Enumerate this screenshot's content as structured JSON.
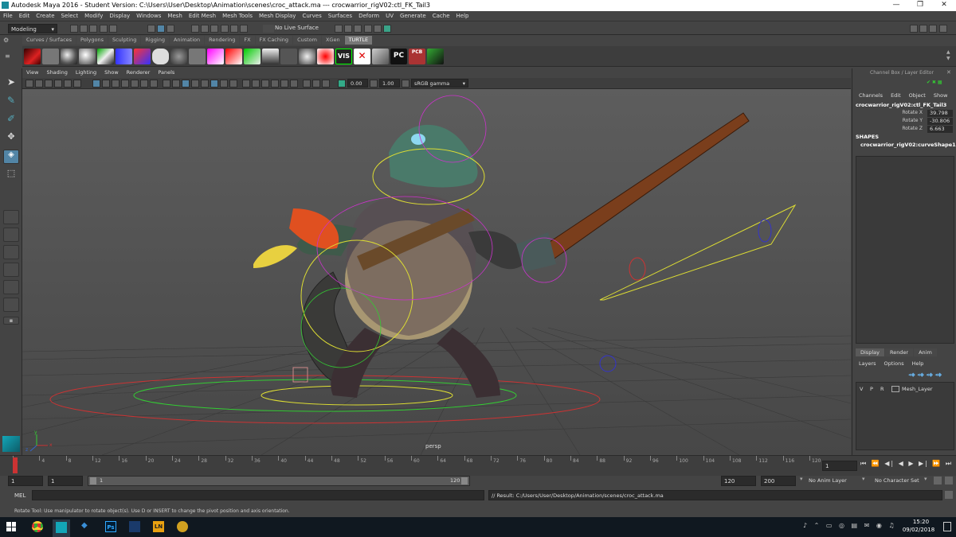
{
  "window": {
    "title": "Autodesk Maya 2016 - Student Version: C:\\Users\\User\\Desktop\\Animation\\scenes\\croc_attack.ma   ---   crocwarrior_rigV02:ctl_FK_Tail3",
    "minimize": "—",
    "maximize": "❐",
    "close": "✕"
  },
  "menubar": [
    "File",
    "Edit",
    "Create",
    "Select",
    "Modify",
    "Display",
    "Windows",
    "Mesh",
    "Edit Mesh",
    "Mesh Tools",
    "Mesh Display",
    "Curves",
    "Surfaces",
    "Deform",
    "UV",
    "Generate",
    "Cache",
    "Help"
  ],
  "statusline": {
    "menuset": "Modeling",
    "live_surface": "No Live Surface"
  },
  "shelf_tabs": [
    "Curves / Surfaces",
    "Polygons",
    "Sculpting",
    "Rigging",
    "Animation",
    "Rendering",
    "FX",
    "FX Caching",
    "Custom",
    "XGen",
    "TURTLE"
  ],
  "shelf_tab_active": "TURTLE",
  "shelf_labels": {
    "vis": "VIS",
    "pc": "PC",
    "pcb": "PCB"
  },
  "viewport": {
    "menu": [
      "View",
      "Shading",
      "Lighting",
      "Show",
      "Renderer",
      "Panels"
    ],
    "exposure": "0.00",
    "gamma": "1.00",
    "colorspace": "sRGB gamma",
    "camera_label": "persp",
    "axis_x": "x",
    "axis_y": "y",
    "axis_z": "z"
  },
  "channel_box": {
    "header": "Channel Box / Layer Editor",
    "menu": [
      "Channels",
      "Edit",
      "Object",
      "Show"
    ],
    "object_name": "crocwarrior_rigV02:ctl_FK_Tail3",
    "channels": [
      {
        "name": "Rotate X",
        "value": "39.798"
      },
      {
        "name": "Rotate Y",
        "value": "-30.806"
      },
      {
        "name": "Rotate Z",
        "value": "6.663"
      }
    ],
    "shapes_label": "SHAPES",
    "shape_name": "crocwarrior_rigV02:curveShape1"
  },
  "layer_editor": {
    "tabs": [
      "Display",
      "Render",
      "Anim"
    ],
    "tab_active": "Display",
    "menu": [
      "Layers",
      "Options",
      "Help"
    ],
    "layer_flags": [
      "V",
      "P",
      "R"
    ],
    "layer_name": "Mesh_Layer"
  },
  "timeline": {
    "ticks": [
      "1",
      "4",
      "8",
      "12",
      "16",
      "20",
      "24",
      "28",
      "32",
      "36",
      "40",
      "44",
      "48",
      "52",
      "56",
      "60",
      "64",
      "68",
      "72",
      "76",
      "80",
      "84",
      "88",
      "92",
      "96",
      "100",
      "104",
      "108",
      "112",
      "116",
      "120"
    ],
    "current_frame": "1",
    "current_field": "1"
  },
  "range": {
    "start": "1",
    "playback_start": "1",
    "slider_start": "1",
    "slider_end": "120",
    "playback_end": "120",
    "end": "200",
    "anim_layer": "No Anim Layer",
    "char_set": "No Character Set"
  },
  "command": {
    "lang": "MEL",
    "result": "// Result: C:/Users/User/Desktop/Animation/scenes/croc_attack.ma"
  },
  "helpline": "Rotate Tool: Use manipulator to rotate object(s). Use D or INSERT to change the pivot position and axis orientation.",
  "taskbar": {
    "time": "15:20",
    "date": "09/02/2018",
    "apps": [
      "Ps",
      "LN"
    ]
  },
  "colors": {
    "ui_bg": "#444444",
    "field_bg": "#2b2b2b",
    "accent": "#5285a6",
    "taskbar": "#101820"
  }
}
